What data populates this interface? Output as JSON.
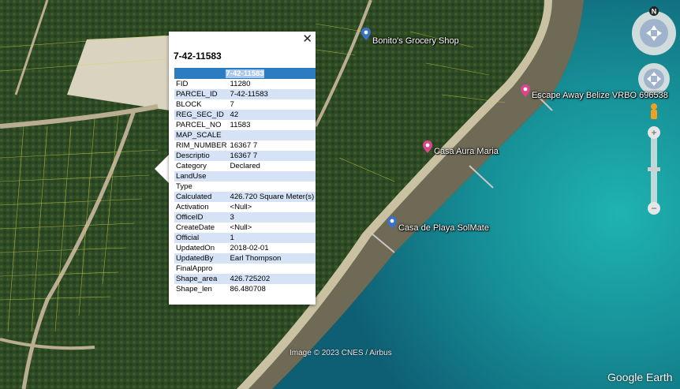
{
  "map": {
    "places": [
      {
        "name": "Bonito's Grocery Shop",
        "pin": "blue-pin-icon"
      },
      {
        "name": "Escape Away Belize VRBO 696538",
        "pin": "pink-pin-icon"
      },
      {
        "name": "Casa Aura Maria",
        "pin": "pink-pin-icon"
      },
      {
        "name": "Casa de Playa SolMate",
        "pin": "blue-pin-icon"
      }
    ],
    "credit": "Image © 2023 CNES / Airbus",
    "brand": "Google Earth",
    "compass_letter": "N"
  },
  "popup": {
    "title": "7-42-11583",
    "close_glyph": "✕",
    "table_header": "7-42-11583",
    "rows": [
      {
        "key": "FID",
        "value": "11280"
      },
      {
        "key": "PARCEL_ID",
        "value": "7-42-11583"
      },
      {
        "key": "BLOCK",
        "value": "7"
      },
      {
        "key": "REG_SEC_ID",
        "value": "42"
      },
      {
        "key": "PARCEL_NO",
        "value": "11583"
      },
      {
        "key": "MAP_SCALE",
        "value": ""
      },
      {
        "key": "RIM_NUMBER",
        "value": "16367 7"
      },
      {
        "key": "Descriptio",
        "value": "16367 7"
      },
      {
        "key": "Category",
        "value": "Declared"
      },
      {
        "key": "LandUse",
        "value": ""
      },
      {
        "key": "Type",
        "value": ""
      },
      {
        "key": "Calculated",
        "value": "426.720 Square Meter(s)"
      },
      {
        "key": "Activation",
        "value": "<Null>"
      },
      {
        "key": "OfficeID",
        "value": "3"
      },
      {
        "key": "CreateDate",
        "value": "<Null>"
      },
      {
        "key": "Official",
        "value": "1"
      },
      {
        "key": "UpdatedOn",
        "value": "2018-02-01"
      },
      {
        "key": "UpdatedBy",
        "value": "Earl Thompson"
      },
      {
        "key": "FinalAppro",
        "value": ""
      },
      {
        "key": "Shape_area",
        "value": "426.725202"
      },
      {
        "key": "Shape_len",
        "value": "86.480708"
      }
    ]
  },
  "colors": {
    "pin_blue": "#3b73c4",
    "pin_pink": "#d9468c",
    "header_blue": "#2c7cc1",
    "row_alt": "#d6e2f5"
  }
}
